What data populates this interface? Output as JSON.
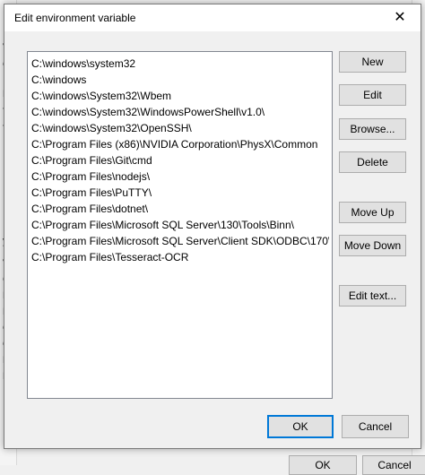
{
  "background": {
    "left_fragments": [
      "Va",
      "Or",
      "Pa",
      "TE",
      "TN",
      "yst",
      "Va",
      "Co",
      "Dr",
      "NU",
      "Or",
      "OS",
      "Pa",
      "PA"
    ],
    "top_fragment": "ser",
    "bottom_buttons": [
      "OK",
      "Cancel"
    ]
  },
  "dialog": {
    "title": "Edit environment variable",
    "close_glyph": "✕"
  },
  "paths": [
    "C:\\windows\\system32",
    "C:\\windows",
    "C:\\windows\\System32\\Wbem",
    "C:\\windows\\System32\\WindowsPowerShell\\v1.0\\",
    "C:\\windows\\System32\\OpenSSH\\",
    "C:\\Program Files (x86)\\NVIDIA Corporation\\PhysX\\Common",
    "C:\\Program Files\\Git\\cmd",
    "C:\\Program Files\\nodejs\\",
    "C:\\Program Files\\PuTTY\\",
    "C:\\Program Files\\dotnet\\",
    "C:\\Program Files\\Microsoft SQL Server\\130\\Tools\\Binn\\",
    "C:\\Program Files\\Microsoft SQL Server\\Client SDK\\ODBC\\170\\To...",
    "C:\\Program Files\\Tesseract-OCR"
  ],
  "buttons": {
    "new": "New",
    "edit": "Edit",
    "browse": "Browse...",
    "delete": "Delete",
    "move_up": "Move Up",
    "move_down": "Move Down",
    "edit_text": "Edit text...",
    "ok": "OK",
    "cancel": "Cancel"
  }
}
